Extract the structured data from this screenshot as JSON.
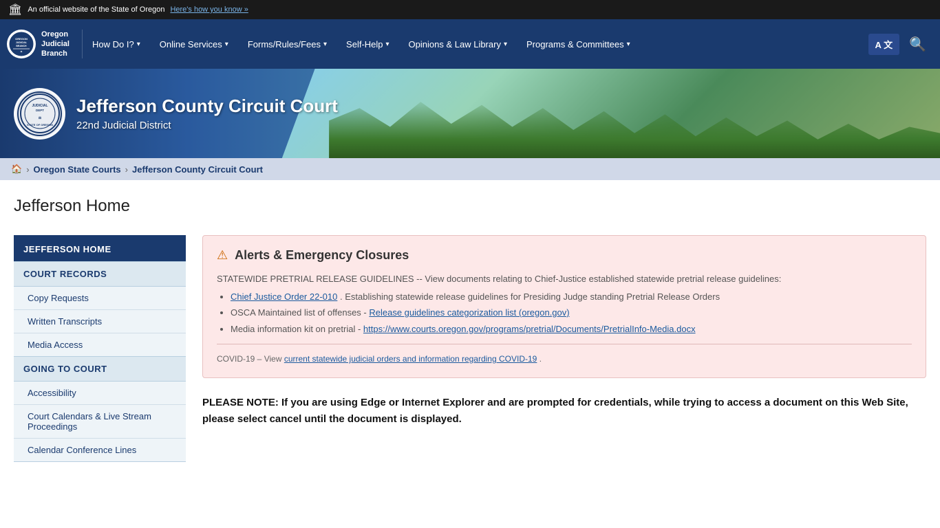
{
  "topBar": {
    "flag": "🏛",
    "text": "An official website of the State of Oregon",
    "linkText": "Here's how you know »"
  },
  "nav": {
    "logoLine1": "Oregon",
    "logoLine2": "Judicial",
    "logoLine3": "Branch",
    "items": [
      {
        "id": "how-do-i",
        "label": "How Do I?",
        "hasDropdown": true
      },
      {
        "id": "online-services",
        "label": "Online Services",
        "hasDropdown": true
      },
      {
        "id": "forms-rules-fees",
        "label": "Forms/Rules/Fees",
        "hasDropdown": true
      },
      {
        "id": "self-help",
        "label": "Self-Help",
        "hasDropdown": true
      },
      {
        "id": "opinions-law-library",
        "label": "Opinions & Law Library",
        "hasDropdown": true
      },
      {
        "id": "programs-committees",
        "label": "Programs & Committees",
        "hasDropdown": true
      }
    ],
    "langButton": "A",
    "langButton2": "文"
  },
  "hero": {
    "sealText": "JUDICIAL DEPT STATE OF OREGON",
    "title": "Jefferson County Circuit Court",
    "subtitle": "22nd Judicial District"
  },
  "breadcrumb": {
    "homeLabel": "🏠",
    "items": [
      {
        "label": "Oregon State Courts",
        "href": "#"
      },
      {
        "label": "Jefferson County Circuit Court",
        "href": "#"
      }
    ]
  },
  "pageTitle": "Jefferson Home",
  "sidebar": {
    "sections": [
      {
        "id": "jefferson-home",
        "header": "JEFFERSON HOME",
        "active": true,
        "items": []
      },
      {
        "id": "court-records",
        "header": "COURT RECORDS",
        "active": false,
        "items": [
          {
            "label": "Copy Requests"
          },
          {
            "label": "Written Transcripts"
          },
          {
            "label": "Media Access"
          }
        ]
      },
      {
        "id": "going-to-court",
        "header": "GOING TO COURT",
        "active": false,
        "items": [
          {
            "label": "Accessibility"
          },
          {
            "label": "Court Calendars & Live Stream Proceedings"
          },
          {
            "label": "Calendar Conference Lines"
          }
        ]
      }
    ]
  },
  "alert": {
    "iconSymbol": "⚠",
    "title": "Alerts & Emergency Closures",
    "pretrialLabel": "STATEWIDE PRETRIAL RELEASE GUIDELINES -- View documents relating to Chief-Justice established statewide pretrial release guidelines:",
    "links": [
      {
        "text": "Chief Justice Order 22-010",
        "href": "#",
        "suffix": ". Establishing statewide release guidelines for Presiding Judge standing Pretrial Release Orders"
      },
      {
        "text": "Release guidelines categorization list (oregon.gov)",
        "prefix": "OSCA Maintained list of offenses - ",
        "href": "#",
        "suffix": ""
      },
      {
        "text": "https://www.courts.oregon.gov/programs/pretrial/Documents/PretrialInfo-Media.docx",
        "prefix": "Media information kit on pretrial - ",
        "href": "#",
        "suffix": ""
      }
    ],
    "covidPrefix": "COVID-19 – View ",
    "covidLinkText": "current statewide judicial orders and information regarding COVID-19",
    "covidSuffix": "."
  },
  "note": {
    "text": "PLEASE NOTE: If you are using Edge or Internet Explorer and are prompted for credentials, while trying to access a document on this Web Site, please select cancel until the document is displayed."
  }
}
